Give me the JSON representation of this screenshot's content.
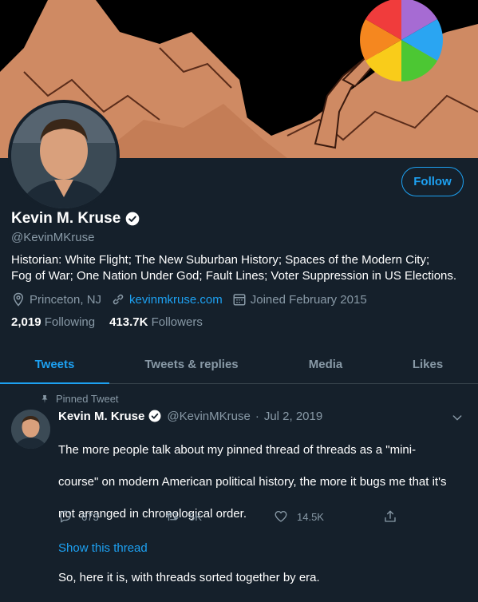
{
  "profile": {
    "follow_label": "Follow",
    "name": "Kevin M. Kruse",
    "handle": "@KevinMKruse",
    "bio_line1": "Historian: White Flight; The New Suburban History; Spaces of the Modern City;",
    "bio_line2": "Fog of War; One Nation Under God; Fault Lines; Voter Suppression in US Elections.",
    "location": "Princeton, NJ",
    "website": "kevinmkruse.com",
    "joined": "Joined February 2015",
    "following_count": "2,019",
    "following_label": "Following",
    "followers_count": "413.7K",
    "followers_label": "Followers"
  },
  "tabs": [
    {
      "label": "Tweets",
      "active": true
    },
    {
      "label": "Tweets & replies",
      "active": false
    },
    {
      "label": "Media",
      "active": false
    },
    {
      "label": "Likes",
      "active": false
    }
  ],
  "tweet": {
    "pinned_label": "Pinned Tweet",
    "author": "Kevin M. Kruse",
    "handle": "@KevinMKruse",
    "separator": "·",
    "date": "Jul 2, 2019",
    "text_line1": "The more people talk about my pinned thread of threads as a \"mini-",
    "text_line2": "course\" on modern American political history, the more it bugs me that it's",
    "text_line3": "not arranged in chronological order.",
    "text_line4": "So, here it is, with threads sorted together by era.",
    "replies": "673",
    "retweets": "5K",
    "likes": "14.5K",
    "show_thread": "Show this thread"
  },
  "icons": [
    "verified-badge-icon",
    "location-icon",
    "link-icon",
    "calendar-icon",
    "pin-icon",
    "chevron-down-icon",
    "reply-icon",
    "retweet-icon",
    "like-icon",
    "share-icon"
  ],
  "colors": {
    "background": "#15202b",
    "accent": "#1da1f2",
    "muted": "#8899a6",
    "banner_terrain": "#d08a62"
  }
}
